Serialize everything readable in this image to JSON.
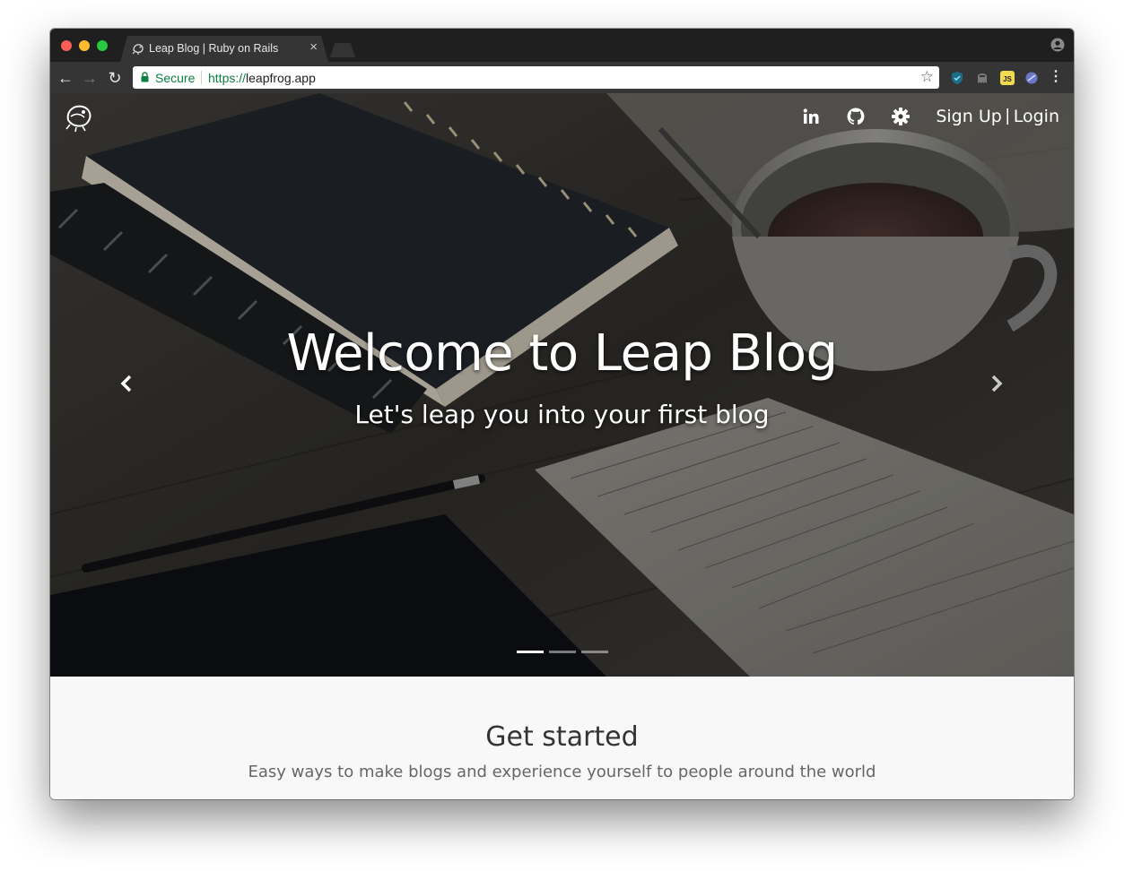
{
  "browser": {
    "tab_title": "Leap Blog | Ruby on Rails",
    "tab_close": "×",
    "secure_label": "Secure",
    "url_scheme": "https://",
    "url_host": "leapfrog.app",
    "back_glyph": "←",
    "forward_glyph": "→",
    "reload_glyph": "↻",
    "star_glyph": "☆",
    "menu_glyph": "⋮"
  },
  "nav": {
    "logo_icon": "frog-logo-icon",
    "icons": [
      "linkedin-icon",
      "github-icon",
      "gear-icon"
    ],
    "signup": "Sign Up",
    "separator": "|",
    "login": "Login"
  },
  "hero": {
    "title": "Welcome to Leap Blog",
    "subtitle": "Let's leap you into your first blog",
    "slides_total": 3,
    "active_slide": 1
  },
  "get_started": {
    "title": "Get started",
    "subtitle": "Easy ways to make blogs and experience yourself to people around the world"
  },
  "colors": {
    "secure_green": "#0b8043",
    "chrome_dark": "#353535",
    "section_bg": "#f8f8f8"
  }
}
